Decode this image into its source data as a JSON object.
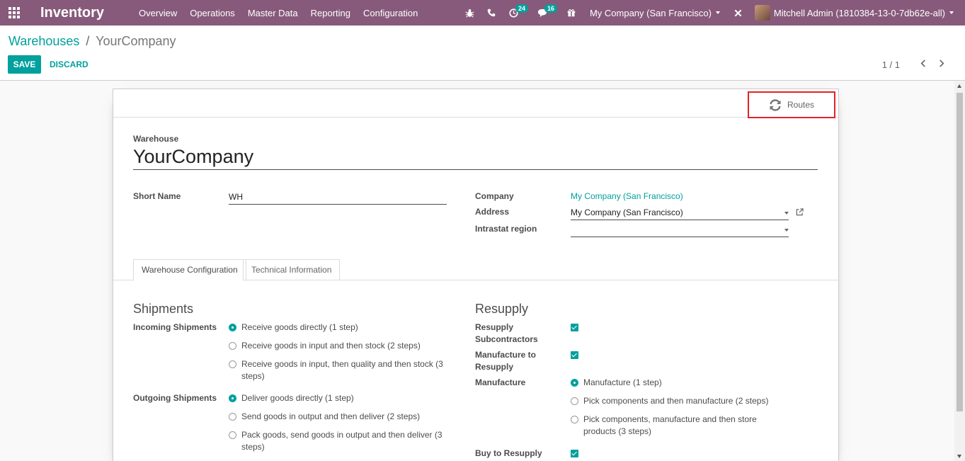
{
  "navbar": {
    "app_name": "Inventory",
    "menu": [
      "Overview",
      "Operations",
      "Master Data",
      "Reporting",
      "Configuration"
    ],
    "activity_count": "24",
    "messages_count": "16",
    "company": "My Company (San Francisco)",
    "user": "Mitchell Admin (1810384-13-0-7db62e-all)"
  },
  "breadcrumb": {
    "parent": "Warehouses",
    "separator": "/",
    "current": "YourCompany"
  },
  "actions": {
    "save": "SAVE",
    "discard": "DISCARD"
  },
  "pager": {
    "counter": "1 / 1"
  },
  "button_box": {
    "routes": "Routes"
  },
  "form": {
    "warehouse_label": "Warehouse",
    "warehouse_name": "YourCompany",
    "short_name_label": "Short Name",
    "short_name_value": "WH",
    "company_label": "Company",
    "company_value": "My Company (San Francisco)",
    "address_label": "Address",
    "address_value": "My Company (San Francisco)",
    "intrastat_label": "Intrastat region",
    "intrastat_value": ""
  },
  "tabs": [
    "Warehouse Configuration",
    "Technical Information"
  ],
  "shipments": {
    "title": "Shipments",
    "incoming_label": "Incoming Shipments",
    "incoming_options": [
      {
        "label": "Receive goods directly (1 step)",
        "selected": true
      },
      {
        "label": "Receive goods in input and then stock (2 steps)",
        "selected": false
      },
      {
        "label": "Receive goods in input, then quality and then stock (3 steps)",
        "selected": false
      }
    ],
    "outgoing_label": "Outgoing Shipments",
    "outgoing_options": [
      {
        "label": "Deliver goods directly (1 step)",
        "selected": true
      },
      {
        "label": "Send goods in output and then deliver (2 steps)",
        "selected": false
      },
      {
        "label": "Pack goods, send goods in output and then deliver (3 steps)",
        "selected": false
      }
    ]
  },
  "resupply": {
    "title": "Resupply",
    "subcontractors_label": "Resupply Subcontractors",
    "manufacture_to_label": "Manufacture to Resupply",
    "manufacture_label": "Manufacture",
    "manufacture_options": [
      {
        "label": "Manufacture (1 step)",
        "selected": true
      },
      {
        "label": "Pick components and then manufacture (2 steps)",
        "selected": false
      },
      {
        "label": "Pick components, manufacture and then store products (3 steps)",
        "selected": false
      }
    ],
    "buy_label": "Buy to Resupply"
  },
  "colors": {
    "brand": "#875a7b",
    "accent": "#00a09d",
    "highlight": "#e0232b"
  }
}
